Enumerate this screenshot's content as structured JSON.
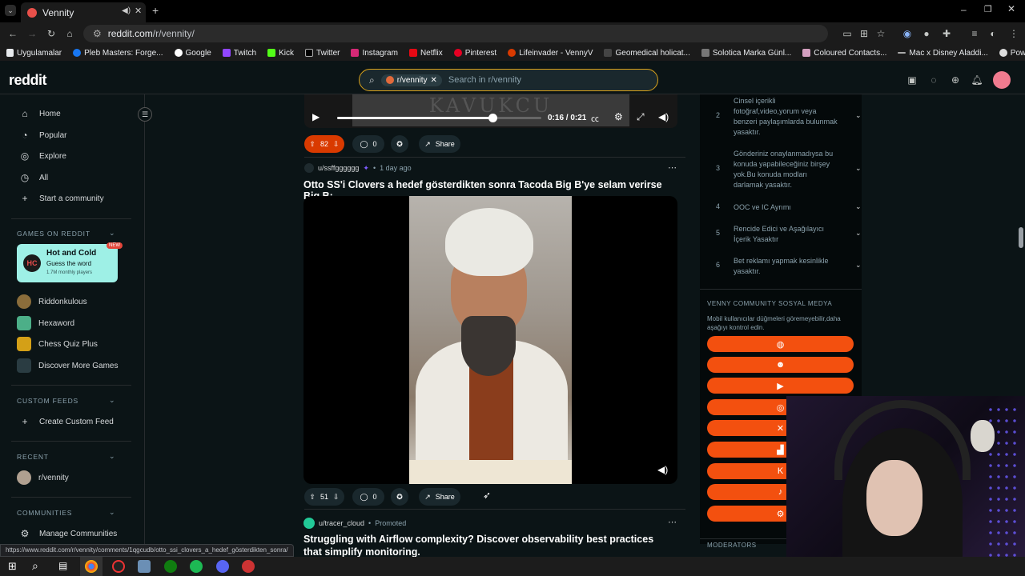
{
  "browser": {
    "tab_title": "Vennity",
    "url_host": "reddit.com",
    "url_path": "/r/vennity/",
    "bookmarks": [
      "Uygulamalar",
      "Pleb Masters: Forge...",
      "Google",
      "Twitch",
      "Kick",
      "Twitter",
      "Instagram",
      "Netflix",
      "Pinterest",
      "Lifeinvader - VennyV",
      "Geomedical holicat...",
      "Solotica Marka Günl...",
      "Coloured Contacts...",
      "Mac x Disney Aladdi...",
      "Powder Kiss Ruj | Tü..."
    ],
    "status_url": "https://www.reddit.com/r/vennity/comments/1qgcudb/otto_ssi_clovers_a_hedef_gösterdikten_sonra/"
  },
  "header": {
    "logo": "reddit",
    "search_chip": "r/vennity",
    "search_placeholder": "Search in r/vennity"
  },
  "leftnav": {
    "home": "Home",
    "popular": "Popular",
    "explore": "Explore",
    "all": "All",
    "start_community": "Start a community",
    "games_header": "GAMES ON REDDIT",
    "hot_title": "Hot and Cold",
    "hot_sub": "Guess the word",
    "hot_players": "1.7M monthly players",
    "new_badge": "NEW",
    "games": [
      "Riddonkulous",
      "Hexaword",
      "Chess Quiz Plus"
    ],
    "discover_games": "Discover More Games",
    "custom_feeds_header": "CUSTOM FEEDS",
    "create_feed": "Create Custom Feed",
    "recent_header": "RECENT",
    "recent_item": "r/vennity",
    "communities_header": "COMMUNITIES",
    "manage_communities": "Manage Communities"
  },
  "feed": {
    "video1": {
      "time": "0:16 / 0:21",
      "thumb_text": "KAVUKCU",
      "progress": 0.76,
      "votes": "82",
      "comments": "0",
      "share": "Share"
    },
    "post2": {
      "author": "u/ssffgggggg",
      "age": "1 day ago",
      "title": "Otto SS'i Clovers a hedef gösterdikten sonra Tacoda Big B'ye selam verirse Big B:",
      "votes": "51",
      "comments": "0",
      "share": "Share"
    },
    "post3": {
      "author": "u/tracer_cloud",
      "promoted": "Promoted",
      "title": "Struggling with Airflow complexity? Discover observability best practices that simplify monitoring."
    }
  },
  "sidebar": {
    "rules": [
      {
        "num": "2",
        "text": "Cinsel içerikli fotoğraf,video,yorum veya benzeri paylaşımlarda bulunmak yasaktır."
      },
      {
        "num": "3",
        "text": "Gönderiniz onaylanmadıysa bu konuda yapabileceğiniz birşey yok.Bu konuda modları darlamak yasaktır."
      },
      {
        "num": "4",
        "text": "OOC ve IC Ayrımı"
      },
      {
        "num": "5",
        "text": "Rencide Edici ve Aşağılayıcı İçerik Yasaktır"
      },
      {
        "num": "6",
        "text": "Bet reklamı yapmak kesinlikle yasaktır."
      }
    ],
    "social_header": "VENNY COMMUNITY SOSYAL MEDYA",
    "social_note": "Mobil kullanıcılar düğmeleri göremeyebilir,daha aşağıyı kontrol edin.",
    "social_buttons": [
      "globe-icon",
      "discord-icon",
      "youtube-icon",
      "instagram-icon",
      "x-icon",
      "twitch-icon",
      "kick-icon",
      "tiktok-icon",
      "steam-icon"
    ],
    "moderators_header": "MODERATORS"
  },
  "colors": {
    "accent": "#f3500f",
    "background": "#0b1416",
    "upvote": "#d93a00"
  }
}
